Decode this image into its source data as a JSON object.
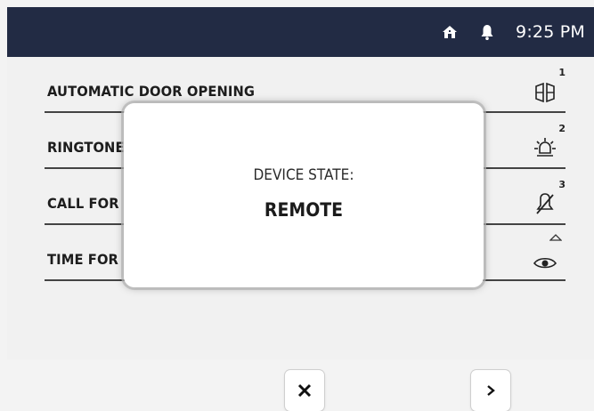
{
  "status_bar": {
    "time": "9:25 PM",
    "icons": [
      "home-icon",
      "bell-icon"
    ],
    "background": "#222b44"
  },
  "settings": [
    {
      "label": "AUTOMATIC DOOR OPENING",
      "badge": "1",
      "icon": "door-open-icon"
    },
    {
      "label": "RINGTONE",
      "badge": "2",
      "icon": "light-icon"
    },
    {
      "label": "CALL FOR",
      "badge": "3",
      "icon": "mute-bell-icon"
    },
    {
      "label": "TIME FOR",
      "badge": "",
      "icon": "eye-icon"
    }
  ],
  "modal": {
    "title": "DEVICE STATE:",
    "value": "REMOTE"
  },
  "buttons": {
    "close": "close-icon",
    "next": "chevron-right-icon"
  }
}
